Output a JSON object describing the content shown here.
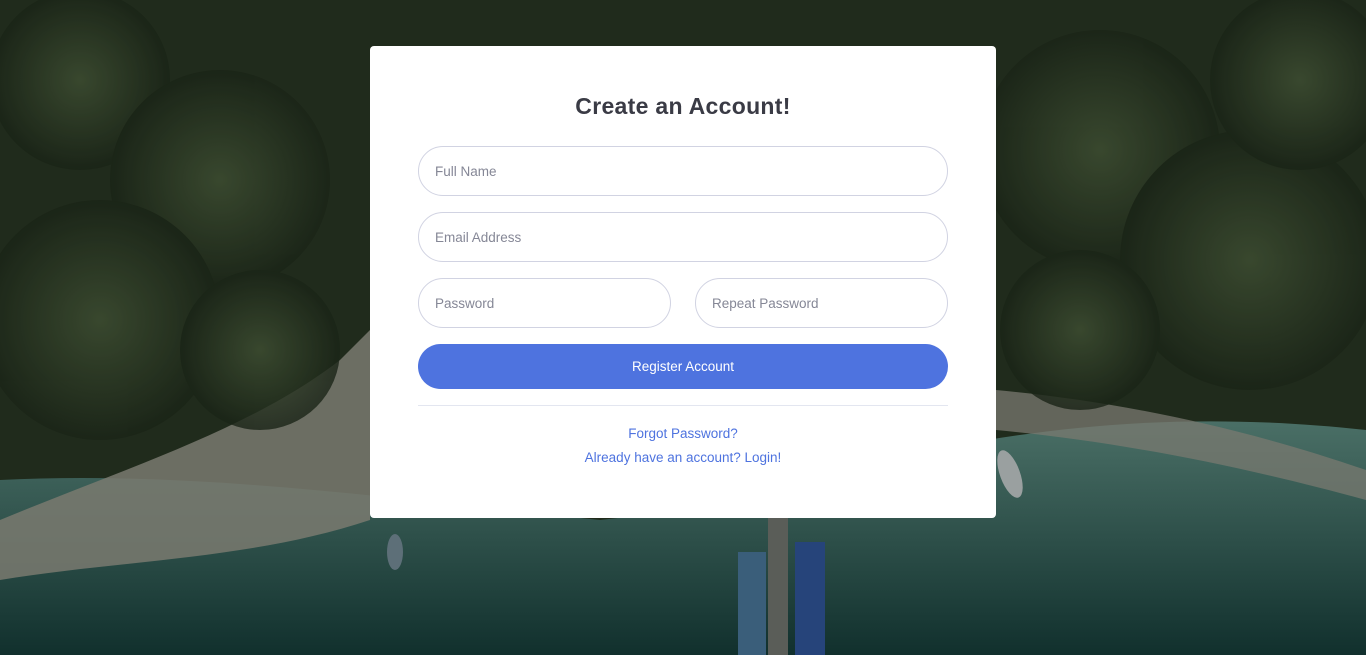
{
  "background": {
    "description_icon": "aerial-beach-photo"
  },
  "form": {
    "title": "Create an Account!",
    "full_name_placeholder": "Full Name",
    "email_placeholder": "Email Address",
    "password_placeholder": "Password",
    "repeat_password_placeholder": "Repeat Password",
    "register_label": "Register Account",
    "forgot_password_label": "Forgot Password?",
    "login_label": "Already have an account? Login!"
  },
  "colors": {
    "primary": "#4e73df",
    "card": "#ffffff",
    "border": "#d1d3e2"
  }
}
